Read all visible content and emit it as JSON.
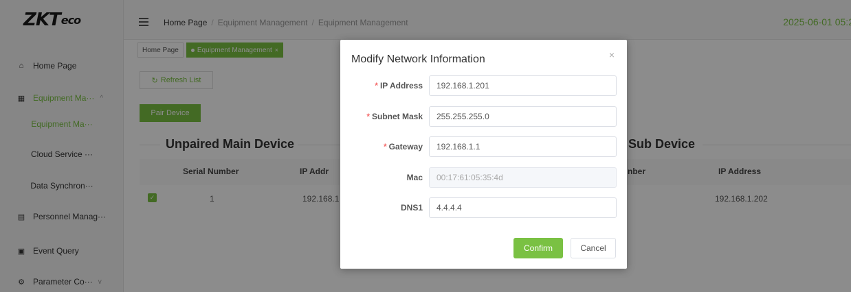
{
  "logo": {
    "main": "ZKT",
    "suffix": "eco"
  },
  "header": {
    "breadcrumb": [
      "Home Page",
      "Equipment Management",
      "Equipment Management"
    ],
    "datetime": "2025-06-01 05:2"
  },
  "tabs": [
    {
      "label": "Home Page"
    },
    {
      "label": "Equipment Management",
      "close": "×"
    }
  ],
  "sidebar": {
    "items": [
      {
        "label": "Home Page",
        "icon": "home-icon"
      },
      {
        "label": "Equipment Ma···",
        "icon": "device-icon",
        "chevron": "^"
      },
      {
        "label": "Personnel Manag···",
        "icon": "personnel-icon"
      },
      {
        "label": "Event Query",
        "icon": "event-icon"
      },
      {
        "label": "Parameter Co···",
        "icon": "settings-icon",
        "chevron": "v"
      }
    ],
    "subitems": [
      {
        "label": "Equipment Ma···"
      },
      {
        "label": "Cloud Service ···"
      },
      {
        "label": "Data Synchron···"
      }
    ]
  },
  "toolbar": {
    "refresh_label": "Refresh List",
    "pair_label": "Pair Device"
  },
  "main_table": {
    "title": "Unpaired Main Device",
    "headers": [
      "Serial Number",
      "IP Addr"
    ],
    "rows": [
      {
        "serial": "1",
        "ip": "192.168.1"
      }
    ]
  },
  "sub_table": {
    "title": "Sub Device",
    "headers": [
      "nber",
      "IP Address"
    ],
    "rows": [
      {
        "ip": "192.168.1.202"
      }
    ]
  },
  "modal": {
    "title": "Modify Network Information",
    "close": "×",
    "fields": [
      {
        "label": "IP Address",
        "required": true,
        "value": "192.168.1.201"
      },
      {
        "label": "Subnet Mask",
        "required": true,
        "value": "255.255.255.0"
      },
      {
        "label": "Gateway",
        "required": true,
        "value": "192.168.1.1"
      },
      {
        "label": "Mac",
        "required": false,
        "value": "00:17:61:05:35:4d"
      },
      {
        "label": "DNS1",
        "required": false,
        "value": "4.4.4.4"
      }
    ],
    "confirm_label": "Confirm",
    "cancel_label": "Cancel"
  },
  "colors": {
    "accent": "#7ac143",
    "required": "#f56c6c"
  }
}
